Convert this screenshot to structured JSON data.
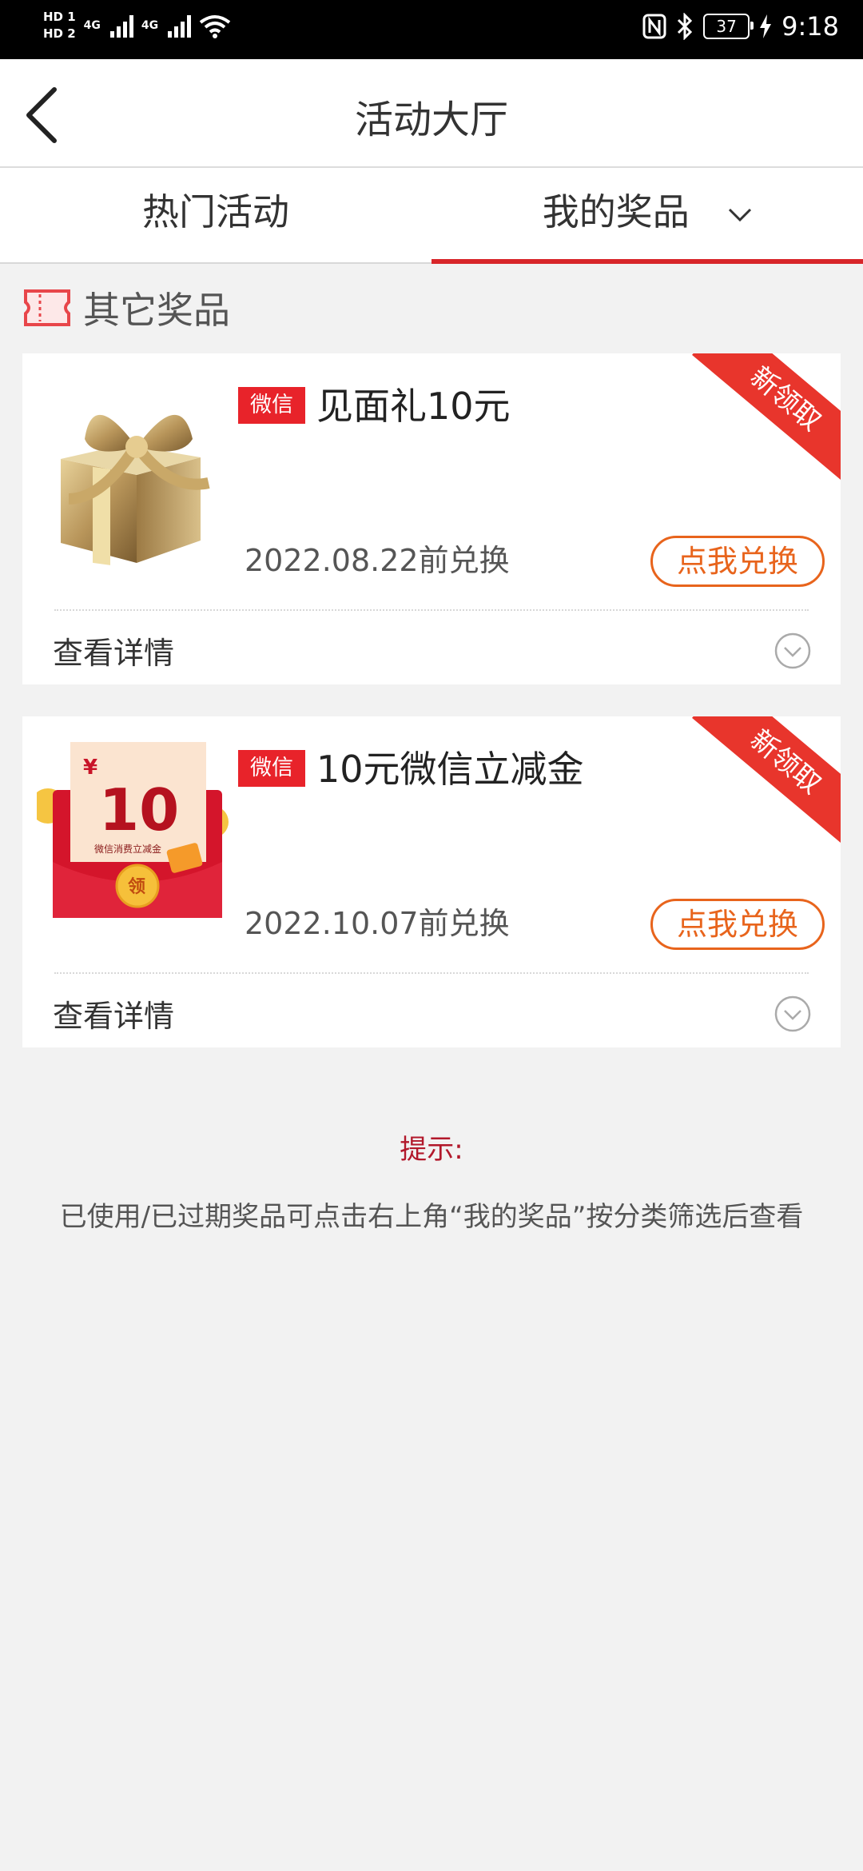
{
  "status_bar": {
    "hd1": "HD 1",
    "hd2": "HD 2",
    "net1": "4G",
    "net2": "4G",
    "battery": "37",
    "time": "9:18"
  },
  "header": {
    "title": "活动大厅"
  },
  "tabs": [
    {
      "label": "热门活动",
      "active": false
    },
    {
      "label": "我的奖品",
      "active": true
    }
  ],
  "section": {
    "title": "其它奖品"
  },
  "prizes": [
    {
      "tag": "微信",
      "title": "见面礼10元",
      "date": "2022.08.22前兑换",
      "button": "点我兑换",
      "ribbon": "新领取",
      "details": "查看详情",
      "image": "gift-box"
    },
    {
      "tag": "微信",
      "title": "10元微信立减金",
      "date": "2022.10.07前兑换",
      "button": "点我兑换",
      "ribbon": "新领取",
      "details": "查看详情",
      "image": "red-envelope",
      "image_text": {
        "currency": "¥",
        "amount": "10",
        "caption": "微信消费立减金",
        "seal": "领"
      }
    }
  ],
  "tip": {
    "label": "提示:",
    "text": "已使用/已过期奖品可点击右上角“我的奖品”按分类筛选后查看"
  },
  "colors": {
    "accent": "#d8262a",
    "orange": "#e8641c",
    "tag": "#e8232a"
  }
}
